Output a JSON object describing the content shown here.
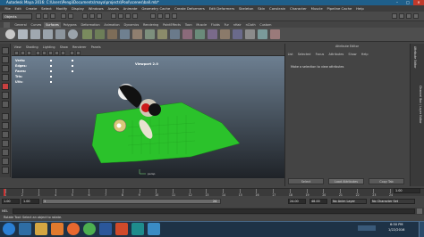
{
  "window": {
    "title": "Autodesk Maya 2016: C:\\Users\\Pengi\\Documents\\maya\\projects\\Pool\\scenes\\ball.mb*",
    "min": "–",
    "max": "□",
    "close": "✕"
  },
  "menus": [
    "File",
    "Edit",
    "Create",
    "Select",
    "Modify",
    "Display",
    "Windows",
    "Assets",
    "Animate",
    "Geometry Cache",
    "Create Deformers",
    "Edit Deformers",
    "Skeleton",
    "Skin",
    "Constrain",
    "Character",
    "Muscle",
    "Pipeline Cache",
    "Help"
  ],
  "status": {
    "mode": "Objects"
  },
  "shelf_tabs": [
    "General",
    "Curves",
    "Surfaces",
    "Polygons",
    "Deformation",
    "Animation",
    "Dynamics",
    "Rendering",
    "PaintEffects",
    "Toon",
    "Muscle",
    "Fluids",
    "Fur",
    "nHair",
    "nCloth",
    "Custom"
  ],
  "shelf_active": "Surfaces",
  "panel_menus": [
    "View",
    "Shading",
    "Lighting",
    "Show",
    "Renderer",
    "Panels"
  ],
  "hud": {
    "labels": [
      "Verts:",
      "Edges:",
      "Faces:",
      "Tris:",
      "UVs:"
    ]
  },
  "viewport": {
    "label": "Viewport 2.0",
    "axis": "persp"
  },
  "attribute_editor": {
    "title": "Attribute Editor",
    "menus": [
      "List",
      "Selected",
      "Focus",
      "Attributes",
      "Show",
      "Help"
    ],
    "message": "Make a selection to view attributes",
    "buttons": [
      "Select",
      "Load Attributes",
      "Copy Tab"
    ]
  },
  "side_tabs": [
    "Attribute Editor",
    "Channel Box / Layer Editor"
  ],
  "timeline": {
    "ticks": [
      "1",
      "2",
      "3",
      "4",
      "5",
      "6",
      "7",
      "8",
      "9",
      "10",
      "11",
      "12",
      "13",
      "14",
      "15",
      "16",
      "17",
      "18",
      "19",
      "20",
      "21",
      "22",
      "23",
      "24"
    ],
    "current_frame": "1.00"
  },
  "range": {
    "start": "1.00",
    "inner_start": "1.00",
    "slider_label": "1",
    "slider_end": "24",
    "end": "24.00",
    "outer_end": "48.00",
    "anim_layer": "No Anim Layer",
    "char_set": "No Character Set"
  },
  "mel": {
    "label": "MEL"
  },
  "help_line": "Rotate Tool: Select an object to rotate.",
  "taskbar": {
    "time": "6:50 PM",
    "date": "1/22/2016"
  },
  "colors": {
    "title_bar": "#1f5f8a",
    "accent": "#5d7fa3",
    "plane": "#2bc22b",
    "viewport_top": "#6d7f91",
    "viewport_bottom": "#1f2328"
  }
}
